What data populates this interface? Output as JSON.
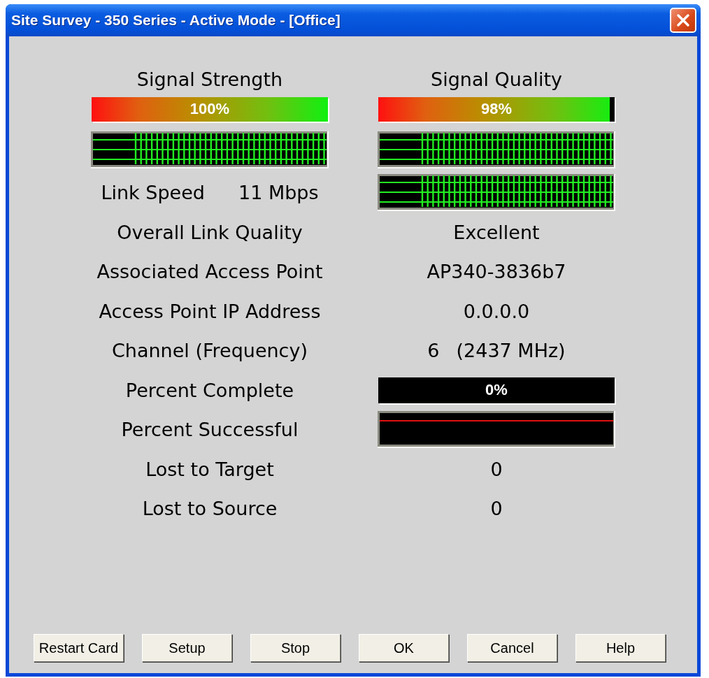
{
  "window": {
    "title": "Site Survey - 350 Series - Active Mode - [Office]"
  },
  "meters": [
    {
      "label": "Signal Strength",
      "level": 1,
      "reading": "100%"
    },
    {
      "label": "Signal Quality",
      "level": 0.98,
      "reading": "98%"
    }
  ],
  "link_speed": {
    "label": "Link Speed",
    "value": "11 Mbps"
  },
  "fields": [
    {
      "kind": "text",
      "label": "Overall Link Quality",
      "value": "Excellent"
    },
    {
      "kind": "text",
      "label": "Associated Access Point",
      "value": "AP340-3836b7"
    },
    {
      "kind": "text",
      "label": "Access Point IP Address",
      "value": "0.0.0.0"
    },
    {
      "kind": "channel",
      "label": "Channel (Frequency)",
      "value": "6",
      "frequency": "(2437 MHz)"
    },
    {
      "kind": "progress",
      "label": "Percent Complete",
      "reading": "0%"
    },
    {
      "kind": "graph",
      "label": "Percent Successful"
    },
    {
      "kind": "text",
      "label": "Lost to Target",
      "value": "0"
    },
    {
      "kind": "text",
      "label": "Lost to Source",
      "value": "0"
    }
  ],
  "buttons": [
    "Restart Card",
    "Setup",
    "Stop",
    "OK",
    "Cancel",
    "Help"
  ]
}
